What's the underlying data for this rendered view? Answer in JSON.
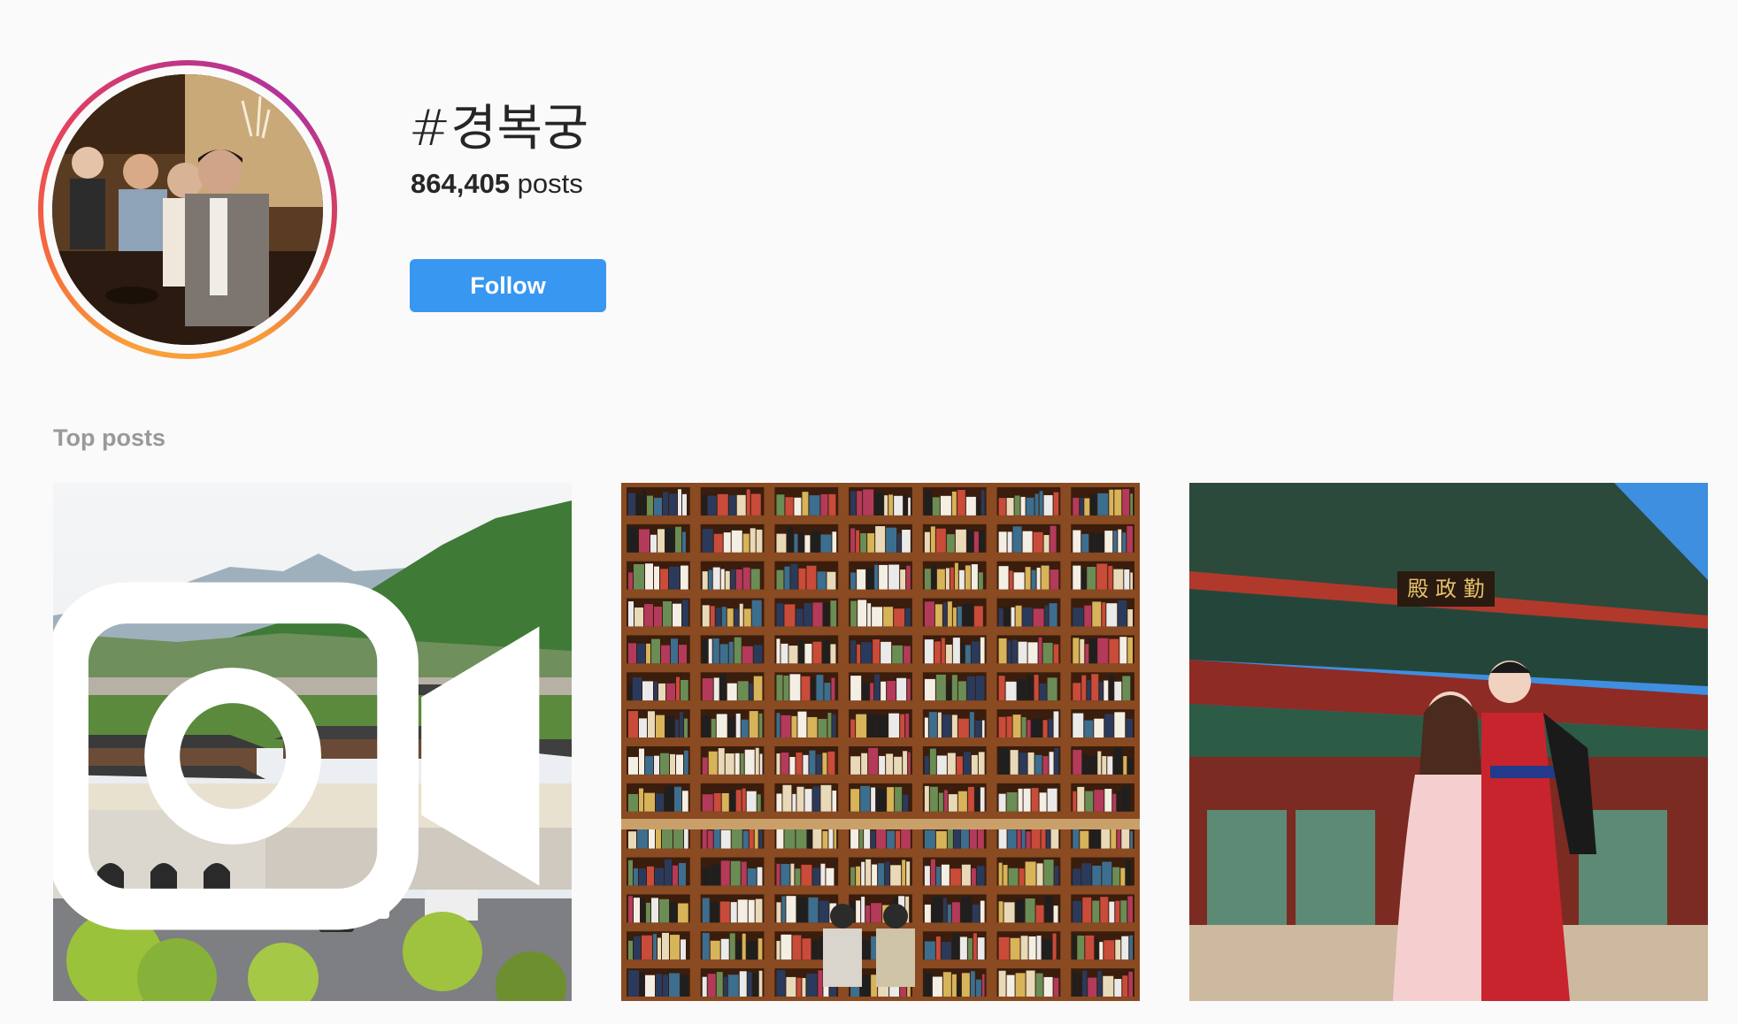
{
  "header": {
    "hashtag": "#경복궁",
    "post_count": "864,405",
    "post_count_suffix": " posts",
    "follow_label": "Follow"
  },
  "top_posts": {
    "section_label": "Top posts",
    "posts": [
      {
        "type": "video",
        "icon": "video-camera-icon",
        "subject": "palace-landscape"
      },
      {
        "type": "photo",
        "subject": "library-bookshelves"
      },
      {
        "type": "photo",
        "subject": "palace-hanbok"
      }
    ]
  },
  "colors": {
    "background": "#fafafa",
    "follow_button": "#3897f0",
    "story_ring_start": "#f9a13b",
    "story_ring_end": "#c13584"
  }
}
